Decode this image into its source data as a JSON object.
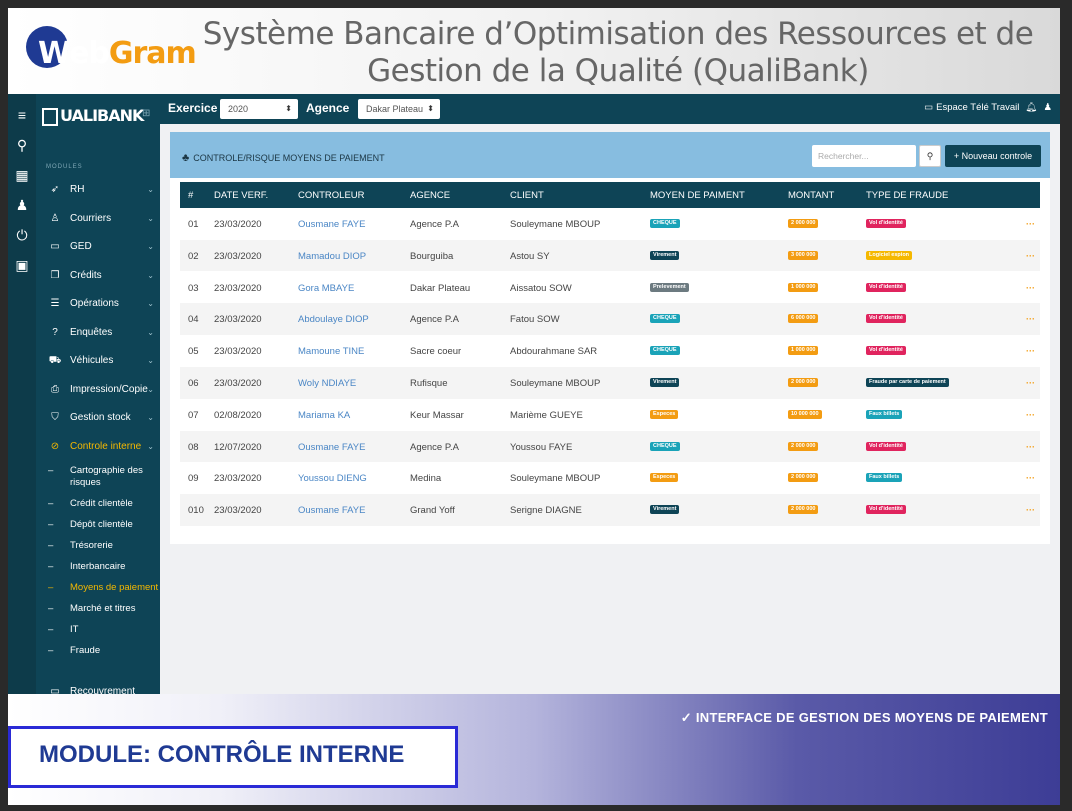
{
  "banner": {
    "logo_a": "Web",
    "logo_b": "Gram",
    "title_line1": "Système Bancaire d’Optimisation des Ressources et de",
    "title_line2": "Gestion de la Qualité (QualiBank)"
  },
  "sidebar": {
    "logo_text": "UALIBANK",
    "modules_label": "MODULES",
    "items": [
      {
        "label": "RH",
        "icon": "rocket-icon"
      },
      {
        "label": "Courriers",
        "icon": "users-icon"
      },
      {
        "label": "GED",
        "icon": "folder-icon"
      },
      {
        "label": "Crédits",
        "icon": "copy-icon"
      },
      {
        "label": "Opérations",
        "icon": "list-icon"
      },
      {
        "label": "Enquêtes",
        "icon": "question-icon"
      },
      {
        "label": "Véhicules",
        "icon": "car-icon"
      },
      {
        "label": "Impression/Copie",
        "icon": "print-icon"
      },
      {
        "label": "Gestion stock",
        "icon": "cart-icon"
      },
      {
        "label": "Controle interne",
        "icon": "check-circle-icon"
      }
    ],
    "subitems": [
      "Cartographie des risques",
      "Crédit clientèle",
      "Dépôt clientèle",
      "Trésorerie",
      "Interbancaire",
      "Moyens de paiement",
      "Marché et titres",
      "IT",
      "Fraude"
    ],
    "bottom_item": "Recouvrement"
  },
  "topbar": {
    "exercice_label": "Exercice",
    "exercice_value": "2020",
    "agence_label": "Agence",
    "agence_value": "Dakar Plateau",
    "teletravail": "Espace Télé Travail"
  },
  "card": {
    "title": "CONTROLE/RISQUE MOYENS DE PAIEMENT",
    "search_placeholder": "Rechercher...",
    "new_button": "+ Nouveau controle"
  },
  "table": {
    "headers": [
      "#",
      "DATE VERF.",
      "CONTROLEUR",
      "AGENCE",
      "CLIENT",
      "MOYEN DE PAIMENT",
      "MONTANT",
      "TYPE DE FRAUDE"
    ],
    "rows": [
      {
        "num": "01",
        "date": "23/03/2020",
        "ctrl": "Ousmane FAYE",
        "agence": "Agence P.A",
        "client": "Souleymane MBOUP",
        "moyen": "CHEQUE",
        "montant": "2 000 000",
        "fraude": "Vol d'identité"
      },
      {
        "num": "02",
        "date": "23/03/2020",
        "ctrl": "Mamadou DIOP",
        "agence": "Bourguiba",
        "client": "Astou SY",
        "moyen": "Virement",
        "montant": "3 000 000",
        "fraude": "Logiciel espion"
      },
      {
        "num": "03",
        "date": "23/03/2020",
        "ctrl": "Gora MBAYE",
        "agence": "Dakar Plateau",
        "client": "Aissatou SOW",
        "moyen": "Prelevement",
        "montant": "1 000 000",
        "fraude": "Vol d'identité"
      },
      {
        "num": "04",
        "date": "23/03/2020",
        "ctrl": "Abdoulaye DIOP",
        "agence": "Agence P.A",
        "client": "Fatou SOW",
        "moyen": "CHEQUE",
        "montant": "6 000 000",
        "fraude": "Vol d'identité"
      },
      {
        "num": "05",
        "date": "23/03/2020",
        "ctrl": "Mamoune TINE",
        "agence": "Sacre coeur",
        "client": "Abdourahmane SAR",
        "moyen": "CHEQUE",
        "montant": "1 000 000",
        "fraude": "Vol d'identité"
      },
      {
        "num": "06",
        "date": "23/03/2020",
        "ctrl": "Woly NDIAYE",
        "agence": "Rufisque",
        "client": "Souleymane MBOUP",
        "moyen": "Virement",
        "montant": "2 000 000",
        "fraude": "Fraude par carte de paiement"
      },
      {
        "num": "07",
        "date": "02/08/2020",
        "ctrl": "Mariama KA",
        "agence": "Keur Massar",
        "client": "Marième GUEYE",
        "moyen": "Especes",
        "montant": "10 000 000",
        "fraude": "Faux billets"
      },
      {
        "num": "08",
        "date": "12/07/2020",
        "ctrl": "Ousmane FAYE",
        "agence": "Agence P.A",
        "client": "Youssou FAYE",
        "moyen": "CHEQUE",
        "montant": "2 000 000",
        "fraude": "Vol d'identité"
      },
      {
        "num": "09",
        "date": "23/03/2020",
        "ctrl": "Youssou DIENG",
        "agence": "Medina",
        "client": "Souleymane MBOUP",
        "moyen": "Especes",
        "montant": "2 000 000",
        "fraude": "Faux billets"
      },
      {
        "num": "010",
        "date": "23/03/2020",
        "ctrl": "Ousmane FAYE",
        "agence": "Grand Yoff",
        "client": "Serigne DIAGNE",
        "moyen": "Virement",
        "montant": "2 000 000",
        "fraude": "Vol d'identité"
      }
    ],
    "more": "···"
  },
  "colors": {
    "moyen": {
      "CHEQUE": "#1aa3b8",
      "Virement": "#0e4456",
      "Prelevement": "#6c7a80",
      "Especes": "#f39c12"
    },
    "montant": "#f39c12",
    "fraude": {
      "Vol d'identité": "#e0245e",
      "Logiciel espion": "#f5b800",
      "Fraude par carte de paiement": "#0e4456",
      "Faux billets": "#1aa3b8"
    }
  },
  "footer": {
    "right_text": "✓ INTERFACE DE GESTION DES MOYENS DE PAIEMENT",
    "module_text": "MODULE: CONTRÔLE INTERNE"
  }
}
